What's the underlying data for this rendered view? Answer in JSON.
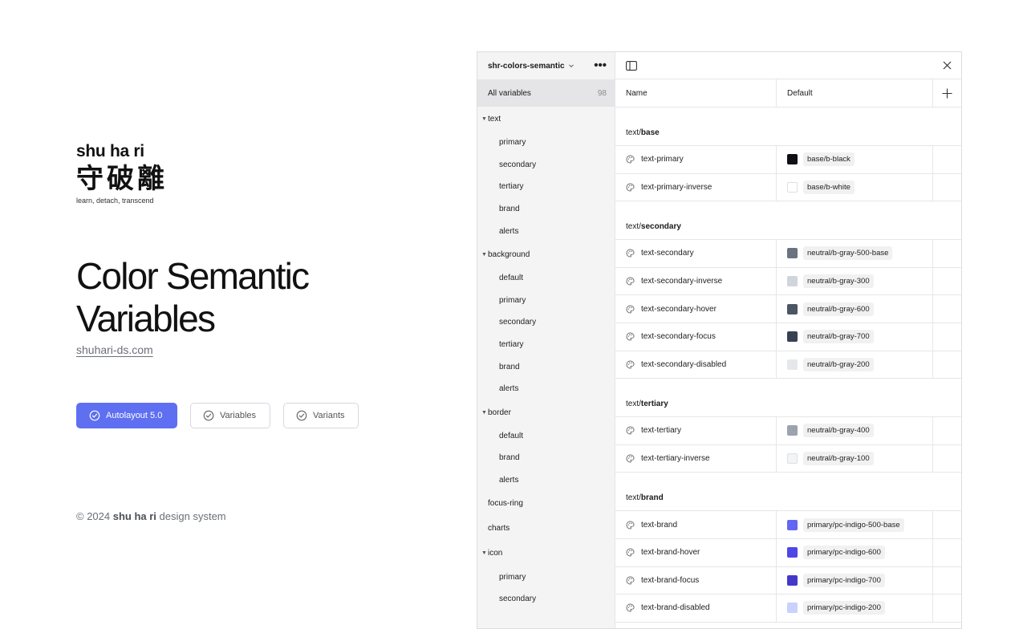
{
  "brand": {
    "name": "shu ha ri",
    "cjk": "守破離",
    "tagline": "learn, detach, transcend"
  },
  "hero": {
    "title_line1": "Color Semantic",
    "title_line2": "Variables",
    "link": "shuhari-ds.com"
  },
  "badges": [
    {
      "label": "Autolayout 5.0",
      "style": "primary"
    },
    {
      "label": "Variables",
      "style": "outline"
    },
    {
      "label": "Variants",
      "style": "outline"
    }
  ],
  "footer": {
    "prefix": "© 2024 ",
    "brand": "shu ha ri",
    "suffix": " design system"
  },
  "panel": {
    "collection": "shr-colors-semantic",
    "all_variables": "All variables",
    "all_count": "98",
    "columns": {
      "name": "Name",
      "default": "Default"
    },
    "groups": [
      {
        "label": "text",
        "items": [
          "primary",
          "secondary",
          "tertiary",
          "brand",
          "alerts"
        ]
      },
      {
        "label": "background",
        "items": [
          "default",
          "primary",
          "secondary",
          "tertiary",
          "brand",
          "alerts"
        ]
      },
      {
        "label": "border",
        "items": [
          "default",
          "brand",
          "alerts"
        ]
      },
      {
        "label": "focus-ring",
        "items": []
      },
      {
        "label": "charts",
        "items": []
      },
      {
        "label": "icon",
        "items": [
          "primary",
          "secondary"
        ]
      }
    ],
    "sections": [
      {
        "prefix": "text/",
        "bold": "base",
        "rows": [
          {
            "name": "text-primary",
            "value": "base/b-black",
            "color": "#0f1014"
          },
          {
            "name": "text-primary-inverse",
            "value": "base/b-white",
            "color": "#ffffff"
          }
        ]
      },
      {
        "prefix": "text/",
        "bold": "secondary",
        "rows": [
          {
            "name": "text-secondary",
            "value": "neutral/b-gray-500-base",
            "color": "#6b7280"
          },
          {
            "name": "text-secondary-inverse",
            "value": "neutral/b-gray-300",
            "color": "#d1d5db"
          },
          {
            "name": "text-secondary-hover",
            "value": "neutral/b-gray-600",
            "color": "#4b5563"
          },
          {
            "name": "text-secondary-focus",
            "value": "neutral/b-gray-700",
            "color": "#374151"
          },
          {
            "name": "text-secondary-disabled",
            "value": "neutral/b-gray-200",
            "color": "#e5e7eb"
          }
        ]
      },
      {
        "prefix": "text/",
        "bold": "tertiary",
        "rows": [
          {
            "name": "text-tertiary",
            "value": "neutral/b-gray-400",
            "color": "#9ca3af"
          },
          {
            "name": "text-tertiary-inverse",
            "value": "neutral/b-gray-100",
            "color": "#f3f4f6"
          }
        ]
      },
      {
        "prefix": "text/",
        "bold": "brand",
        "rows": [
          {
            "name": "text-brand",
            "value": "primary/pc-indigo-500-base",
            "color": "#6366f1"
          },
          {
            "name": "text-brand-hover",
            "value": "primary/pc-indigo-600",
            "color": "#4f46e5"
          },
          {
            "name": "text-brand-focus",
            "value": "primary/pc-indigo-700",
            "color": "#4338ca"
          },
          {
            "name": "text-brand-disabled",
            "value": "primary/pc-indigo-200",
            "color": "#c7d2fe"
          }
        ]
      }
    ]
  },
  "colors": {
    "accent": "#5e6ff1",
    "muted_text": "#6b6f78"
  }
}
